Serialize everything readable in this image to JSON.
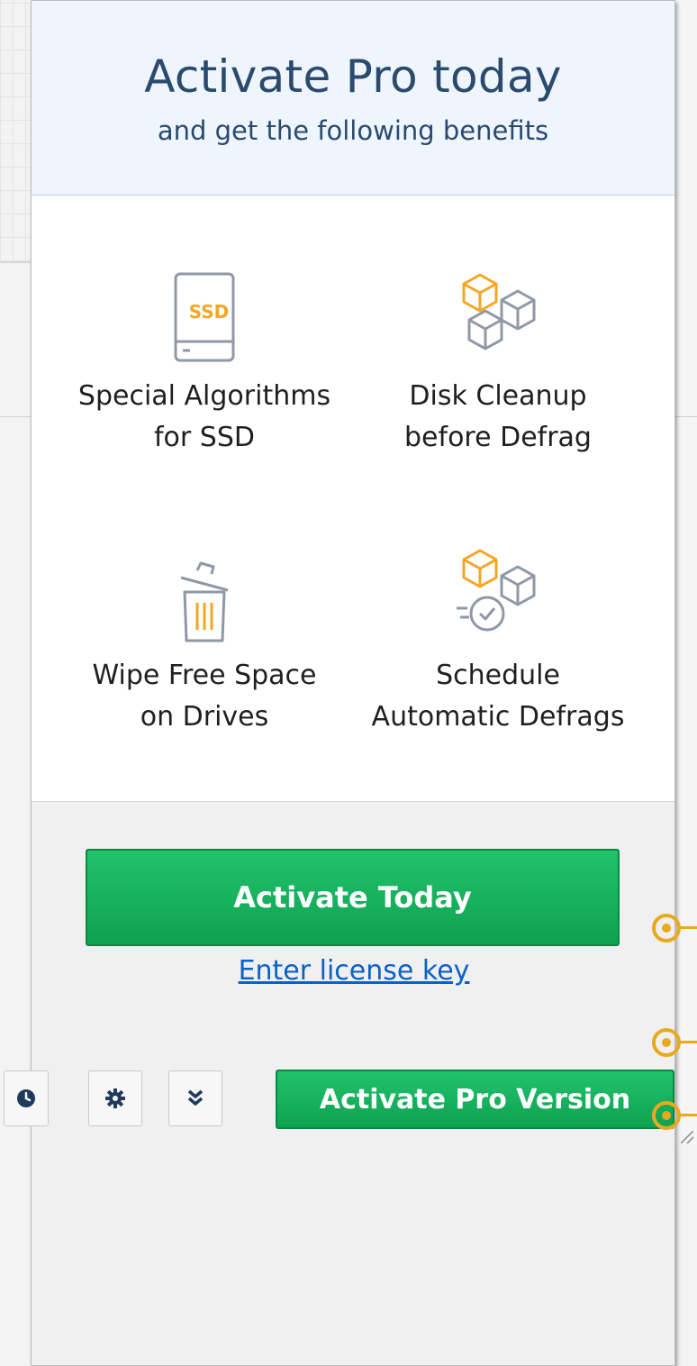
{
  "popup": {
    "title": "Activate Pro today",
    "subtitle": "and get the following benefits",
    "benefits": [
      {
        "label": "Special Algorithms\nfor SSD",
        "icon": "ssd-icon"
      },
      {
        "label": "Disk Cleanup\nbefore Defrag",
        "icon": "cubes-cleanup-icon"
      },
      {
        "label": "Wipe Free Space\non Drives",
        "icon": "trash-bin-icon"
      },
      {
        "label": "Schedule\nAutomatic Defrags",
        "icon": "cubes-schedule-icon"
      }
    ],
    "ssd_text": "SSD",
    "activate_button": "Activate Today",
    "license_link": "Enter license key"
  },
  "toolbar": {
    "buttons": [
      "clock-icon",
      "gear-icon",
      "chevron-double-down-icon"
    ],
    "pro_button": "Activate Pro Version"
  },
  "colors": {
    "accent_green": "#14ab5a",
    "header_text": "#2a4a6e",
    "icon_orange": "#f5a623",
    "marker_orange": "#e9a91d",
    "link_blue": "#0a61c9"
  }
}
